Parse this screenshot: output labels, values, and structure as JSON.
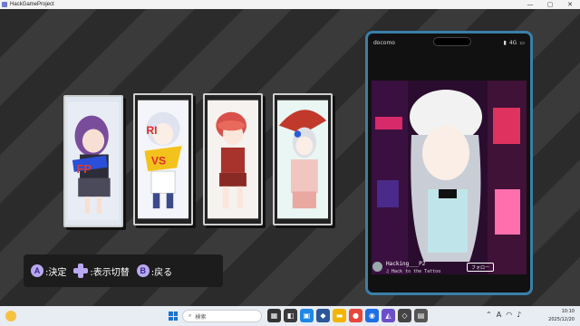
{
  "window": {
    "title": "HackGameProject",
    "minimize": "—",
    "maximize": "▢",
    "close": "✕"
  },
  "legend": {
    "a_button": "A",
    "a_label": ":決定",
    "dpad_label": ":表示切替",
    "b_button": "B",
    "b_label": ":戻る"
  },
  "phone": {
    "carrier": "docomo",
    "signal": "4G",
    "username": "Hacking___P2",
    "song": "♫ Hack to the Tattoo",
    "follow_label": "フォロー"
  },
  "cards": [
    {
      "text": "FP"
    },
    {
      "text": "RI VS"
    },
    {
      "text": ""
    },
    {
      "text": ""
    }
  ],
  "taskbar": {
    "search_placeholder": "検索",
    "ime_label": "A",
    "time": "10:10",
    "date": "2025/12/20"
  },
  "colors": {
    "accent": "#b8a8f0",
    "phone_frame": "#3a7fa8"
  }
}
